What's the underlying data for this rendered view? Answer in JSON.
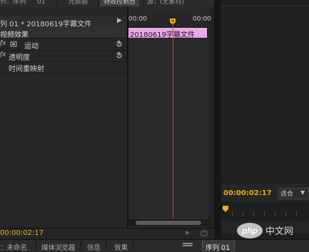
{
  "top_tabs": {
    "tab1": "列：序列",
    "tab2": "01",
    "tab3": "元数据",
    "tab4": "特效控制台",
    "tab5": "源：(无素材)"
  },
  "effect_controls": {
    "sequence_label": "列 01 * 20180619字幕文件",
    "video_effects_label": "视频效果",
    "effects": [
      {
        "label": "运动",
        "has_reset": true
      },
      {
        "label": "透明度",
        "has_reset": true
      },
      {
        "label": "时间重映射",
        "has_reset": false
      }
    ],
    "ruler_start": "00:00",
    "ruler_end": "00:00",
    "clip_label": "20180619字幕文件",
    "current_timecode": "00:00:02:17"
  },
  "program_monitor": {
    "timecode": "00:00:02:17",
    "fit_label": "适合"
  },
  "bottom_tabs": {
    "unnamed": "：未命名",
    "media_browser": "媒体浏览器",
    "info": "信息",
    "effects": "效果",
    "sequence": "序列 01"
  },
  "colors": {
    "timecode": "#e8b020",
    "clip": "#e9a9e6",
    "playhead": "#c0404a"
  },
  "watermark_text": "php 中文网"
}
